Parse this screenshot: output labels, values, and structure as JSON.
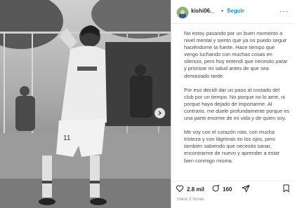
{
  "post": {
    "username": "kishi06._",
    "separator": "•",
    "follow_label": "Seguir",
    "more_label": "···",
    "caption": [
      "No estoy pasando por un buen momento a nivel mental y siento que ya no puedo seguir haciéndome la fuerte. Hace tiempo que vengo luchando con muchas cosas en silencio, pero hoy entendí que necesito parar y priorizar mi salud antes de que sea demasiado tarde.",
      "Por eso decidí dar un paso al costado del club por un tiempo. No porque no lo ame, ni porque haya dejado de importarme. Al contrario, me duele profundamente porque es una parte enorme de mi vida y de quien soy.",
      "Me voy con el corazón roto, con mucha tristeza y con lágrimas en los ojos, pero también sabiendo que necesito sanar, encontrarme de nuevo y aprender a estar bien conmigo misma."
    ],
    "likes": "2.8 mil",
    "comments": "160",
    "time": "Hace 2 horas"
  },
  "icons": {
    "next": "chevron-right-icon",
    "like": "heart-icon",
    "comment": "comment-icon",
    "share": "share-icon",
    "save": "bookmark-icon",
    "more": "more-options-icon"
  },
  "colors": {
    "link": "#0095f6",
    "text": "#262626",
    "muted": "#8e8e8e"
  }
}
